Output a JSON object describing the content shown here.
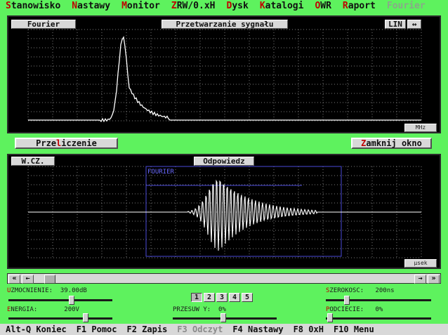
{
  "menu": [
    {
      "hk": "S",
      "rest": "tanowisko"
    },
    {
      "hk": "N",
      "rest": "astawy"
    },
    {
      "hk": "M",
      "rest": "onitor"
    },
    {
      "hk": "Z",
      "rest": "RW/0.xH"
    },
    {
      "hk": "D",
      "rest": "ysk"
    },
    {
      "hk": "K",
      "rest": "atalogi"
    },
    {
      "hk": "O",
      "rest": "WR"
    },
    {
      "hk": "R",
      "rest": "aport"
    },
    {
      "hk": "",
      "rest": "Fourier",
      "disabled": true
    }
  ],
  "top_panel": {
    "left_button": "Fourier",
    "title_button": "Przetwarzanie sygnału",
    "scale_button": "LIN",
    "toggle_icon": "↔",
    "unit": "MHz"
  },
  "actions": {
    "recalc": {
      "pre": "Prze",
      "hk": "l",
      "post": "iczenie"
    },
    "close": {
      "pre": "",
      "hk": "Z",
      "post": "amknij okno"
    }
  },
  "bottom_panel": {
    "left_button": "W.CZ.",
    "title_button": "Odpowiedz",
    "overlay_label": "FOURIER",
    "unit": "μsek"
  },
  "scrollbar": {
    "left_far": "«",
    "left": "←",
    "right": "→",
    "right_far": "»"
  },
  "controls": {
    "uzmocnienie": {
      "hk": "U",
      "rest": "ZMOCNIENIE:",
      "value": "39.00dB"
    },
    "energia": {
      "hk": "E",
      "rest": "NERGIA:",
      "value": "200V"
    },
    "przesuw": {
      "label": "PRZESUW Y:",
      "value": "0%"
    },
    "szerokosc": {
      "hk": "S",
      "rest": "ZEROKOSC:",
      "value": "200ns"
    },
    "podciecie": {
      "hk": "P",
      "rest": "ODCIECIE:",
      "value": "0%"
    },
    "tabs": [
      "1",
      "2",
      "3",
      "4",
      "5"
    ]
  },
  "statusbar": [
    {
      "label": "Alt-Q Koniec"
    },
    {
      "label": "F1 Pomoc"
    },
    {
      "label": "F2 Zapis"
    },
    {
      "label": "F3 Odczyt",
      "disabled": true
    },
    {
      "label": "F4 Nastawy"
    },
    {
      "label": "F8 0xH"
    },
    {
      "label": "F10 Menu"
    }
  ],
  "colors": {
    "background": "#5ef25e",
    "hotkey": "#c00000",
    "trace": "#ffffff",
    "grid": "#7a7a7a",
    "gate": "#4a4ad8"
  }
}
